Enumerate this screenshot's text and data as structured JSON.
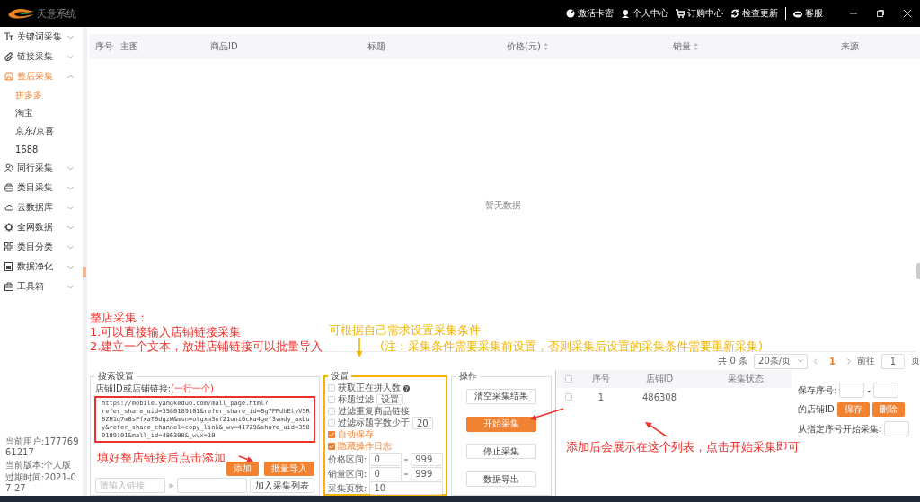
{
  "window": {
    "logo_text": "天意系统",
    "toolbar": [
      {
        "label": "激活卡密"
      },
      {
        "label": "个人中心"
      },
      {
        "label": "订购中心"
      },
      {
        "label": "检查更新"
      },
      {
        "label": "客服",
        "divided": true
      }
    ]
  },
  "sidebar": {
    "items": [
      {
        "label": "关键词采集",
        "selected": false,
        "expanded": false
      },
      {
        "label": "链接采集",
        "selected": false,
        "expanded": false
      },
      {
        "label": "整店采集",
        "selected": true,
        "expanded": true,
        "children": [
          {
            "label": "拼多多",
            "selected": true
          },
          {
            "label": "淘宝",
            "selected": false
          },
          {
            "label": "京东/京喜",
            "selected": false
          },
          {
            "label": "1688",
            "selected": false
          }
        ]
      },
      {
        "label": "同行采集",
        "selected": false,
        "expanded": false
      },
      {
        "label": "类目采集",
        "selected": false,
        "expanded": false
      },
      {
        "label": "云数据库",
        "selected": false,
        "expanded": false
      },
      {
        "label": "全网数据",
        "selected": false,
        "expanded": false
      },
      {
        "label": "类目分类",
        "selected": false,
        "expanded": false
      },
      {
        "label": "数据净化",
        "selected": false,
        "expanded": false
      },
      {
        "label": "工具箱",
        "selected": false,
        "expanded": false
      }
    ],
    "footer": [
      "当前用户:17776961217",
      "当前版本:个人版",
      "过期时间:2021-07-27"
    ]
  },
  "results_table": {
    "columns": [
      {
        "label": "序号",
        "sortable": false
      },
      {
        "label": "主图",
        "sortable": false
      },
      {
        "label": "商品ID",
        "sortable": false
      },
      {
        "label": "标题",
        "sortable": false
      },
      {
        "label": "价格(元)",
        "sortable": true
      },
      {
        "label": "销量",
        "sortable": true
      },
      {
        "label": "来源",
        "sortable": false
      }
    ],
    "empty_text": "暂无数据"
  },
  "pagination": {
    "total": "共 0 条",
    "page_size": "20条/页",
    "pages": [
      {
        "label": "1",
        "selected": true
      }
    ],
    "goto_label": "前往",
    "goto_value": "1",
    "goto_suffix": "页"
  },
  "search_settings": {
    "legend": "搜索设置",
    "field_label": "店铺ID或店铺链接:",
    "field_hint": "(一行一个)",
    "highlighted": true,
    "links_value": "https://mobile.yangkeduo.com/mall_page.html?\nrefer_share_uid=3580189101&refer_share_id=Bg7PPdhEtyV5R8ZH1q7m8sFfxaT6dgzW&msn=otgxm3of21oni6cka4gef3vmdy_axbuy&refer_share_channel=copy_link&_wv=41729&share_uid=3580189101&mall_id=486308&_wvx=10",
    "buttons": [
      "添加",
      "批量导入"
    ],
    "link_placeholder": "请输入链接",
    "separator": "»",
    "add_list_button": "加入采集列表"
  },
  "settings": {
    "legend": "设置",
    "highlighted": true,
    "options": [
      {
        "kind": "help",
        "label": "获取正在拼人数",
        "checked": false
      },
      {
        "kind": "button",
        "label": "标题过滤",
        "checked": false,
        "button_label": "设置"
      },
      {
        "kind": "plain",
        "label": "过滤重复商品链接",
        "checked": false
      },
      {
        "kind": "number",
        "label": "过滤标题字数少于",
        "checked": false,
        "value": "20"
      },
      {
        "kind": "plain",
        "label": "自动保存",
        "checked": true
      },
      {
        "kind": "plain",
        "label": "隐藏操作日志",
        "checked": true
      }
    ],
    "ranges": [
      {
        "label": "价格区间:",
        "from": "0",
        "to": "999"
      },
      {
        "label": "销量区间:",
        "from": "0",
        "to": "999"
      }
    ],
    "pages": {
      "label": "采集页数:",
      "value": "10"
    }
  },
  "operations": {
    "legend": "操作",
    "buttons": [
      {
        "label": "清空采集结果",
        "primary": false
      },
      {
        "label": "开始采集",
        "primary": true
      },
      {
        "label": "停止采集",
        "primary": false
      },
      {
        "label": "数据导出",
        "primary": false
      }
    ]
  },
  "shop_table": {
    "all_checked": false,
    "columns": [
      "序号",
      "店铺ID",
      "采集状态"
    ],
    "rows": [
      {
        "index": "1",
        "shop_id": "486308",
        "checked": false
      }
    ]
  },
  "range_tools": {
    "save_label": "保存序号:",
    "dash": "-",
    "shop_label": "的店铺ID",
    "buttons": [
      "保存",
      "删除"
    ],
    "start_label": "从指定序号开始采集:"
  },
  "annotations": [
    {
      "kind": "block",
      "color": "#f0302a",
      "lines": [
        "整店采集：",
        "1.可以直接输入店铺链接采集",
        "2.建立一个文本，放进店铺链接可以批量导入"
      ]
    },
    {
      "kind": "tip",
      "color": "#f5b400",
      "lines": [
        "可根据自己需求设置采集条件"
      ]
    },
    {
      "kind": "note",
      "color": "#f5b400",
      "lines": [
        "(注：采集条件需要采集前设置，否则采集后设置的采集条件需要重新采集)"
      ]
    },
    {
      "kind": "add",
      "color": "#f0302a",
      "lines": [
        "填好整店链接后点击添加"
      ]
    },
    {
      "kind": "list",
      "color": "#f0302a",
      "lines": [
        "添加后会展示在这个列表，点击开始采集即可"
      ]
    }
  ]
}
